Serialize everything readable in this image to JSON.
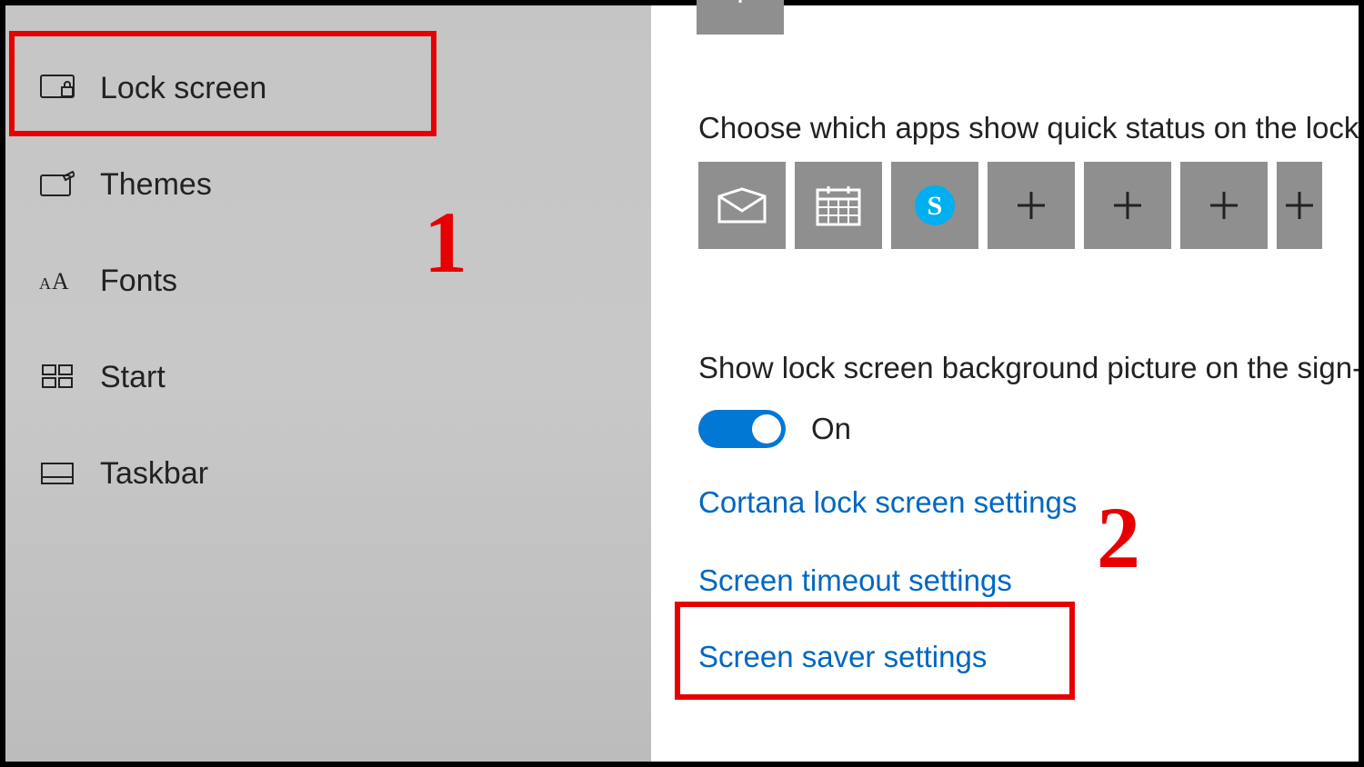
{
  "sidebar": {
    "items": [
      {
        "label": "Lock screen",
        "icon": "lock-screen"
      },
      {
        "label": "Themes",
        "icon": "themes"
      },
      {
        "label": "Fonts",
        "icon": "fonts"
      },
      {
        "label": "Start",
        "icon": "start"
      },
      {
        "label": "Taskbar",
        "icon": "taskbar"
      }
    ]
  },
  "content": {
    "quick_status_heading": "Choose which apps show quick status on the lock s",
    "signin_heading": "Show lock screen background picture on the sign-i",
    "toggle_label": "On",
    "links": {
      "cortana": "Cortana lock screen settings",
      "timeout": "Screen timeout settings",
      "screensaver": "Screen saver settings"
    },
    "app_tiles": [
      {
        "icon": "mail"
      },
      {
        "icon": "calendar"
      },
      {
        "icon": "skype"
      },
      {
        "icon": "plus"
      },
      {
        "icon": "plus"
      },
      {
        "icon": "plus"
      },
      {
        "icon": "plus"
      }
    ]
  },
  "annotations": {
    "step1": "1",
    "step2": "2"
  }
}
